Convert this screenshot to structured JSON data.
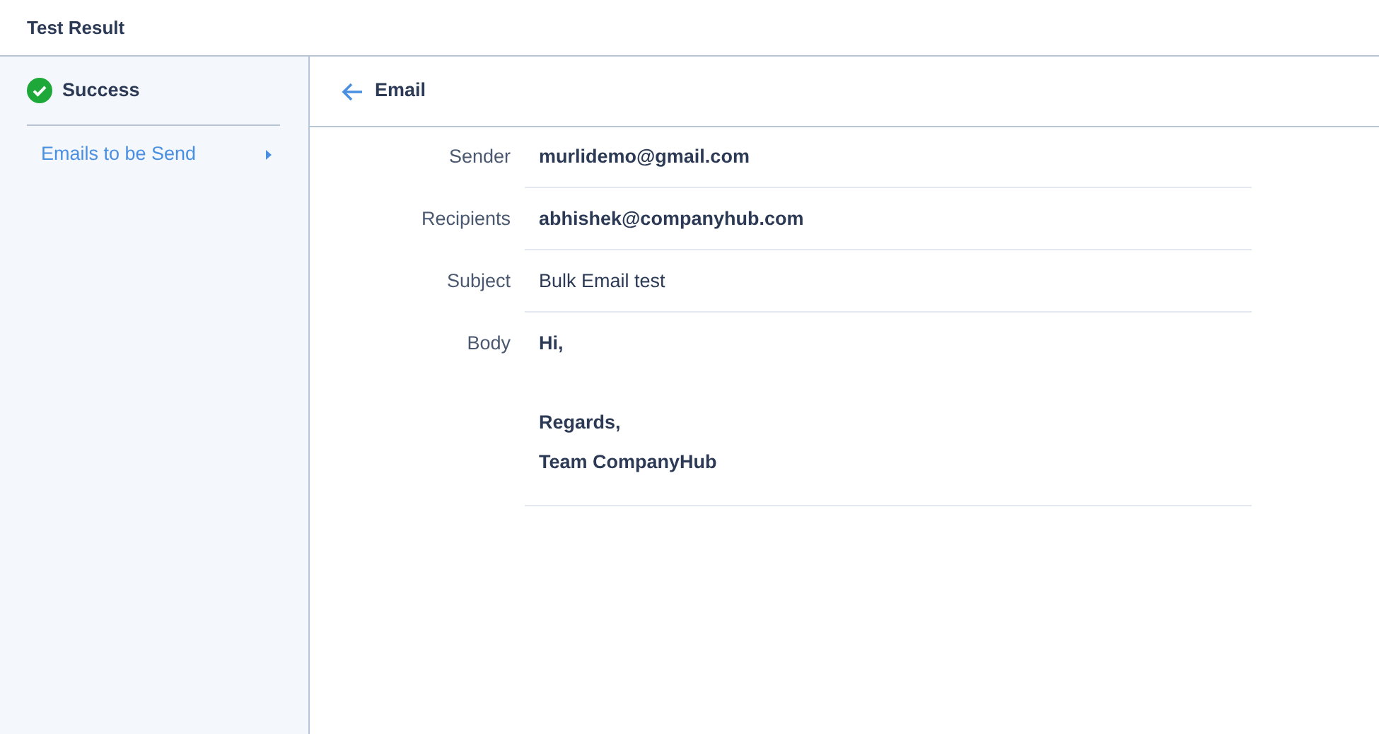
{
  "window": {
    "title": "Test Result"
  },
  "sidebar": {
    "status": {
      "label": "Success",
      "kind": "success"
    },
    "items": [
      {
        "label": "Emails to be Send",
        "selected": true
      }
    ]
  },
  "panel": {
    "title": "Email",
    "fields": [
      {
        "label": "Sender",
        "value": "murlidemo@gmail.com",
        "bold": true
      },
      {
        "label": "Recipients",
        "value": "abhishek@companyhub.com",
        "bold": true
      },
      {
        "label": "Subject",
        "value": "Bulk Email test",
        "bold": false
      }
    ],
    "body": {
      "label": "Body",
      "paragraphs": [
        {
          "lines": [
            "Hi,"
          ]
        },
        {
          "lines": [
            "Regards,",
            "Team CompanyHub"
          ]
        }
      ]
    }
  }
}
